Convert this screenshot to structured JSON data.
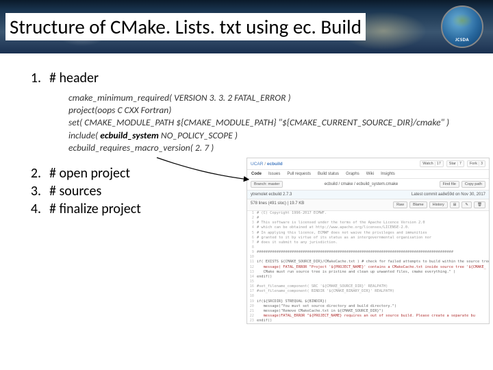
{
  "title": "Structure of CMake. Lists. txt using ec. Build",
  "logo_label": "JCSDA",
  "list": {
    "items": [
      {
        "num": "1.",
        "text": "# header"
      },
      {
        "num": "2.",
        "text": "# open project"
      },
      {
        "num": "3.",
        "text": "# sources"
      },
      {
        "num": "4.",
        "text": "# finalize project"
      }
    ]
  },
  "code": {
    "line1_pre": "cmake_minimum_required( VERSION 3. 3. 2 FATAL_ERROR )",
    "line2": "project(oops C CXX Fortran)",
    "line3": "set( CMAKE_MODULE_PATH ${CMAKE_MODULE_PATH} \"${CMAKE_CURRENT_SOURCE_DIR}/cmake\" )",
    "line4_pre": "include( ",
    "line4_kw": "ecbuild_system",
    "line4_post": " NO_POLICY_SCOPE )",
    "line5": "ecbuild_requires_macro_version( 2. 7 )"
  },
  "github": {
    "org": "UCAR",
    "repo": "ecbuild",
    "stats": {
      "watch_label": "Watch",
      "watch_n": "17",
      "star_label": "Star",
      "star_n": "7",
      "fork_label": "Fork",
      "fork_n": "3"
    },
    "tabs": [
      "Code",
      "Issues",
      "Pull requests",
      "Build status",
      "Graphs",
      "Wiki",
      "Insights"
    ],
    "crumb_branch": "Branch: master",
    "crumb_path": "ecbuild / cmake / ecbuild_system.cmake",
    "crumb_find": "Find file",
    "crumb_copy": "Copy path",
    "commit_msg": "ytremolet ecbuild 2.7.3",
    "commit_meta": "Latest commit aa8e59d on Nov 30, 2017",
    "file_info": "578 lines (491 sloc)  | 19.7 KB",
    "file_actions": [
      "Raw",
      "Blame",
      "History"
    ],
    "lines": [
      {
        "n": "1",
        "t": "# (C) Copyright 1996-2017 ECMWF.",
        "cls": "comment"
      },
      {
        "n": "2",
        "t": "#",
        "cls": "comment"
      },
      {
        "n": "3",
        "t": "# This software is licensed under the terms of the Apache Licence Version 2.0",
        "cls": "comment"
      },
      {
        "n": "4",
        "t": "# which can be obtained at http://www.apache.org/licenses/LICENSE-2.0.",
        "cls": "comment"
      },
      {
        "n": "5",
        "t": "# In applying this licence, ECMWF does not waive the privileges and immunities",
        "cls": "comment"
      },
      {
        "n": "6",
        "t": "# granted to it by virtue of its status as an intergovernmental organisation nor",
        "cls": "comment"
      },
      {
        "n": "7",
        "t": "# does it submit to any jurisdiction.",
        "cls": "comment"
      },
      {
        "n": "8",
        "t": "",
        "cls": ""
      },
      {
        "n": "9",
        "t": "##########################################################################################",
        "cls": "comment"
      },
      {
        "n": "10",
        "t": "",
        "cls": ""
      },
      {
        "n": "11",
        "t": "if( EXISTS ${CMAKE_SOURCE_DIR}/CMakeCache.txt ) # check for failed attempts to build within the source tree",
        "cls": ""
      },
      {
        "n": "12",
        "t": "   message( FATAL_ERROR \"Project '${PROJECT_NAME}' contains a CMakeCache.txt inside source tree '${CMAKE_",
        "cls": "red"
      },
      {
        "n": "13",
        "t": "   CMake must run source tree is pristine and clean up unwanted files, cmake everything.\" )",
        "cls": ""
      },
      {
        "n": "14",
        "t": "endif()",
        "cls": ""
      },
      {
        "n": "15",
        "t": "",
        "cls": ""
      },
      {
        "n": "16",
        "t": "#set_filename_component( SRC '${CMAKE_SOURCE_DIR}' REALPATH)",
        "cls": "comment"
      },
      {
        "n": "17",
        "t": "#set_filename_component( BINDIR '${CMAKE_BINARY_DIR}' REALPATH)",
        "cls": "comment"
      },
      {
        "n": "18",
        "t": "",
        "cls": ""
      },
      {
        "n": "19",
        "t": "if(${SRCDIR} STREQUAL ${BINDIR})",
        "cls": ""
      },
      {
        "n": "20",
        "t": "   message(\"You must set source directory and build directory.\")",
        "cls": ""
      },
      {
        "n": "21",
        "t": "   message(\"Remove CMakeCache.txt in ${CMAKE_SOURCE_DIR}\")",
        "cls": ""
      },
      {
        "n": "22",
        "t": "   message(FATAL_ERROR \"${PROJECT_NAME} requires an out of source build. Please create a separate bu",
        "cls": "red"
      },
      {
        "n": "23",
        "t": "endif()",
        "cls": ""
      }
    ]
  }
}
